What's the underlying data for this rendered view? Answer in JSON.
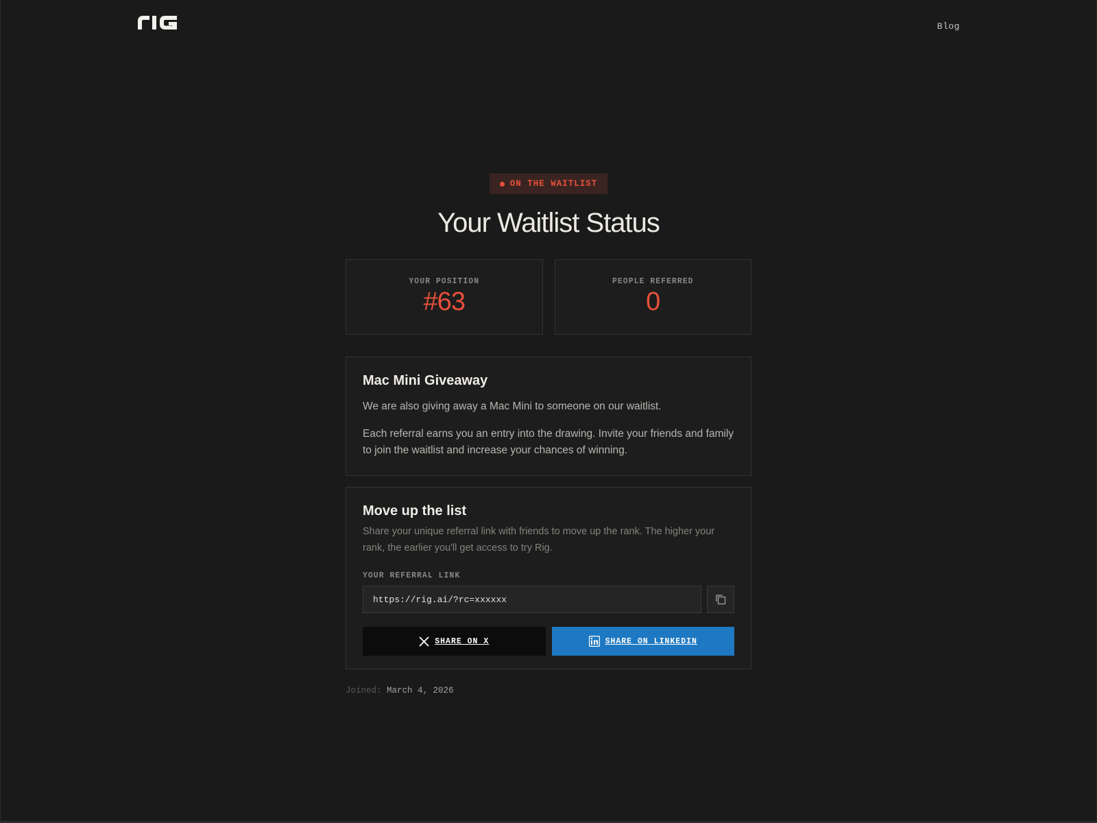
{
  "header": {
    "logo_text": "RIG",
    "nav_blog": "Blog"
  },
  "status": {
    "badge": "ON THE WAITLIST",
    "title": "Your Waitlist Status"
  },
  "stats": {
    "position_label": "YOUR POSITION",
    "position_value": "#63",
    "referred_label": "PEOPLE REFERRED",
    "referred_value": "0"
  },
  "giveaway": {
    "title": "Mac Mini Giveaway",
    "text1": "We are also giving away a Mac Mini to someone on our waitlist.",
    "text2": "Each referral earns you an entry into the drawing. Invite your friends and family to join the waitlist and increase your chances of winning."
  },
  "move_up": {
    "title": "Move up the list",
    "text": "Share your unique referral link with friends to move up the rank. The higher your rank, the earlier you'll get access to try Rig.",
    "link_label": "YOUR REFERRAL LINK",
    "link_value": "https://rig.ai/?rc=xxxxxx",
    "copy_icon": "copy-icon",
    "share_x_label": "SHARE ON X",
    "share_linkedin_label": "SHARE ON LINKEDIN"
  },
  "footer": {
    "joined_label": "Joined:",
    "joined_value": "March 4, 2026"
  },
  "colors": {
    "background": "#1a1a1a",
    "accent": "#e8503a",
    "linkedin": "#1f79c2",
    "x_button": "#0c0c0c"
  }
}
